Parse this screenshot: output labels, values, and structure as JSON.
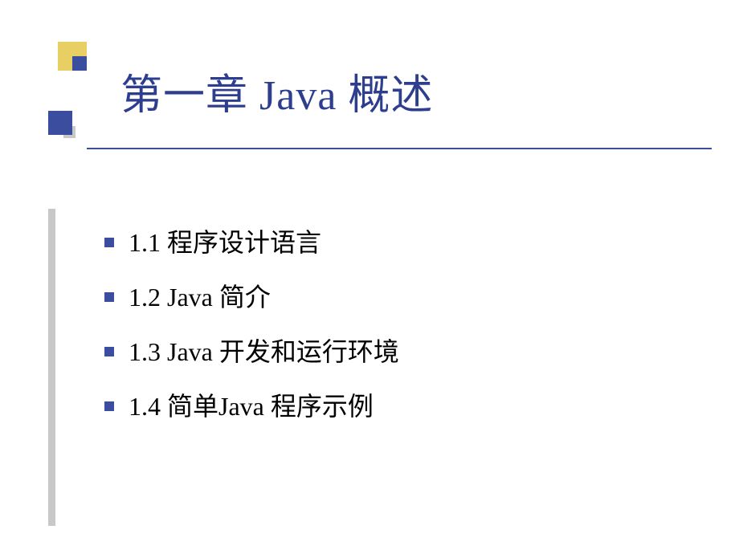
{
  "slide": {
    "title": "第一章 Java 概述",
    "items": [
      {
        "label": "1.1  程序设计语言"
      },
      {
        "label": "1.2  Java 简介"
      },
      {
        "label": "1.3 Java  开发和运行环境"
      },
      {
        "label": "1.4  简单Java 程序示例"
      }
    ]
  }
}
